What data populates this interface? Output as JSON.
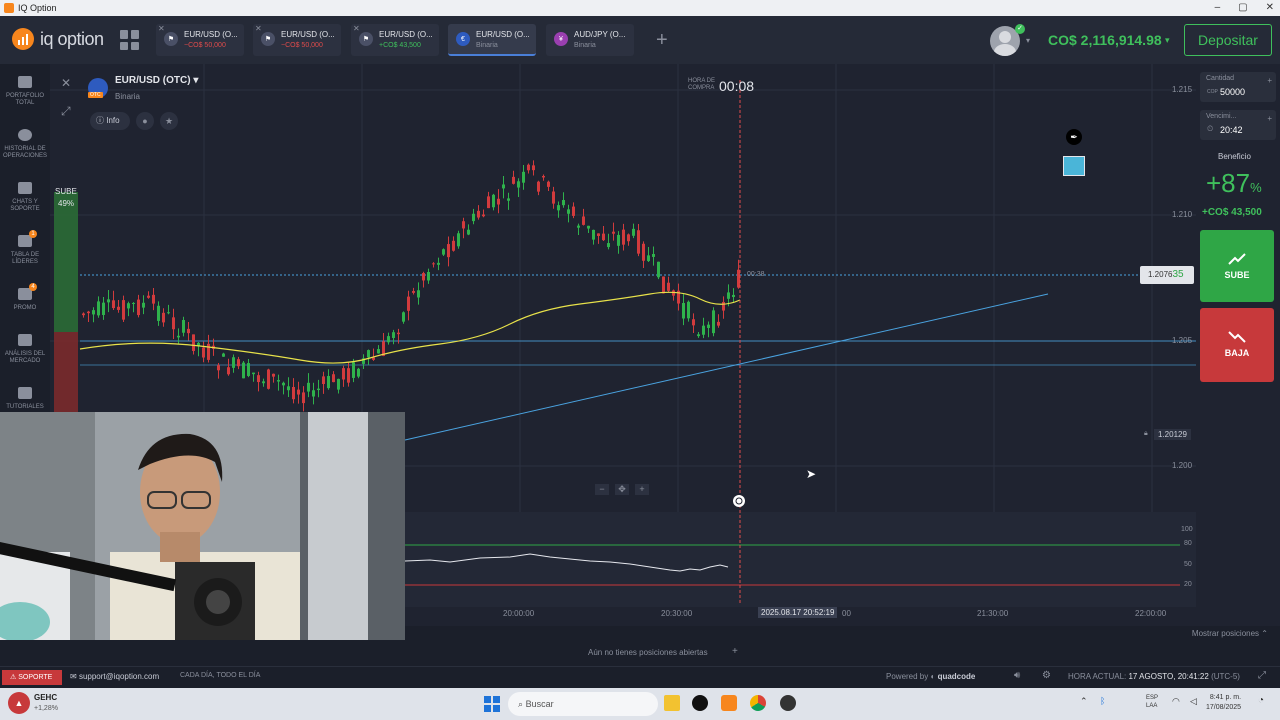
{
  "window": {
    "title": "IQ Option",
    "controls": [
      "–",
      "▢",
      "✕"
    ]
  },
  "header": {
    "logo_text": "iq option",
    "tabs": [
      {
        "name": "EUR/USD (O...",
        "sub": "−CO$ 50,000",
        "tone": "neg"
      },
      {
        "name": "EUR/USD (O...",
        "sub": "−CO$ 50,000",
        "tone": "neg"
      },
      {
        "name": "EUR/USD (O...",
        "sub": "+CO$ 43,500",
        "tone": "pos"
      },
      {
        "name": "EUR/USD (O...",
        "sub": "Binaria",
        "tone": "neutral"
      },
      {
        "name": "AUD/JPY (O...",
        "sub": "Binaria",
        "tone": "neutral"
      }
    ],
    "add_tab": "+",
    "balance": "CO$ 2,116,914.98",
    "deposit_label": "Depositar"
  },
  "sidebar": {
    "items": [
      {
        "label": "PORTAFOLIO TOTAL",
        "icon": "briefcase-icon"
      },
      {
        "label": "HISTORIAL DE OPERACIONES",
        "icon": "history-icon"
      },
      {
        "label": "CHATS Y SOPORTE",
        "icon": "chat-icon"
      },
      {
        "label": "TABLA DE LÍDERES",
        "icon": "trophy-icon",
        "badge": "1"
      },
      {
        "label": "PROMO",
        "icon": "gift-icon",
        "badge": "4"
      },
      {
        "label": "ANÁLISIS DEL MERCADO",
        "icon": "analysis-icon"
      },
      {
        "label": "TUTORIALES",
        "icon": "tutorial-icon"
      }
    ]
  },
  "asset": {
    "name": "EUR/USD (OTC)",
    "type": "Binaria",
    "info_label": "Info",
    "badge": "OTC"
  },
  "sentiment": {
    "up_label": "SUBE",
    "up_pct": "49%"
  },
  "timer": {
    "label_line1": "HORA DE",
    "label_line2": "COMPRA",
    "value": "00:08"
  },
  "chart_info": {
    "price_levels": [
      "1.215",
      "1.210",
      "1.205",
      "1.200"
    ],
    "current_price_main": "1.2076",
    "current_price_tail": "35",
    "order_price": "1.20129",
    "line_timer": "00:38",
    "osc_levels": [
      "100",
      "80",
      "50",
      "20"
    ],
    "time_labels": [
      "20:00:00",
      "20:30:00",
      "21:30:00",
      "22:00:00"
    ],
    "crosshair_time": "2025.08.17 20:52:19",
    "crosshair_time_tail": "00",
    "zoom_minus": "−",
    "zoom_plus": "+"
  },
  "right_panel": {
    "amount_label": "Cantidad",
    "amount_value": "50000",
    "amount_unit": "COP",
    "expiry_label": "Vencimi...",
    "expiry_value": "20:42",
    "benefit_label": "Beneficio",
    "benefit_pct": "+87",
    "benefit_pct_sign": "%",
    "benefit_amount": "+CO$ 43,500",
    "up_button": "SUBE",
    "down_button": "BAJA"
  },
  "bottom": {
    "show_positions": "Mostrar posiciones",
    "no_positions": "Aún no tienes posiciones abiertas",
    "support_label": "SOPORTE",
    "support_email": "support@iqoption.com",
    "support_hours": "CADA DÍA, TODO EL DÍA",
    "powered_by": "Powered by",
    "brand": "quadcode",
    "clock_label": "HORA ACTUAL:",
    "clock_value": "17 AGOSTO, 20:41:22",
    "clock_tz": "(UTC-5)"
  },
  "taskbar": {
    "ticker_name": "GEHC",
    "ticker_change": "+1,28%",
    "search_placeholder": "Buscar",
    "lang_line1": "ESP",
    "lang_line2": "LAA",
    "time": "8:41 p. m.",
    "date": "17/08/2025"
  },
  "colors": {
    "up": "#2fa646",
    "down": "#c7393b",
    "accent": "#f7861d",
    "bg": "#1f2330"
  }
}
